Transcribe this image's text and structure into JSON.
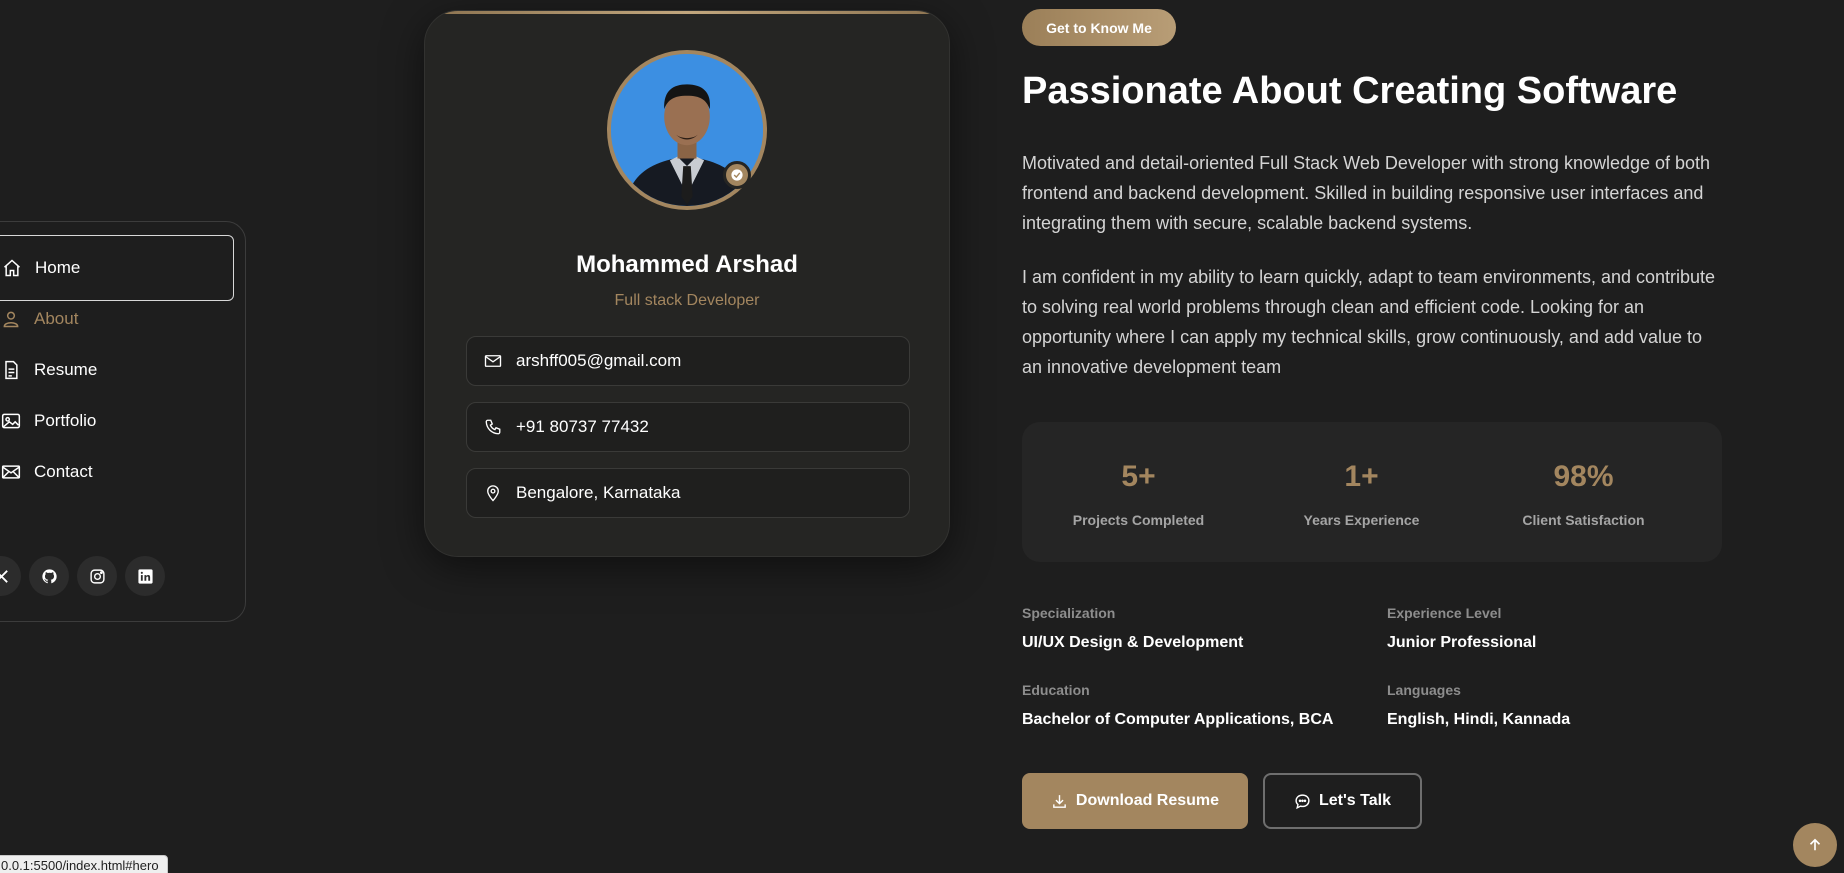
{
  "nav": {
    "items": [
      {
        "label": "Home",
        "icon": "home-icon"
      },
      {
        "label": "About",
        "icon": "user-icon"
      },
      {
        "label": "Resume",
        "icon": "document-icon"
      },
      {
        "label": "Portfolio",
        "icon": "image-icon"
      },
      {
        "label": "Contact",
        "icon": "mail-icon"
      }
    ],
    "socials": [
      "x-icon",
      "github-icon",
      "instagram-icon",
      "linkedin-icon"
    ]
  },
  "profile": {
    "name": "Mohammed Arshad",
    "role": "Full stack Developer",
    "email": "arshff005@gmail.com",
    "phone": "+91 80737 77432",
    "location": "Bengalore, Karnataka"
  },
  "about": {
    "badge": "Get to Know Me",
    "heading": "Passionate About Creating Software",
    "paragraph1": "Motivated and detail-oriented Full Stack Web Developer with strong knowledge of both frontend and backend development. Skilled in building responsive user interfaces and integrating them with secure, scalable backend systems.",
    "paragraph2": "I am confident in my ability to learn quickly, adapt to team environments, and contribute to solving real world problems through clean and efficient code. Looking for an opportunity where I can apply my technical skills, grow continuously, and add value to an innovative development team",
    "stats": [
      {
        "value": "5+",
        "label": "Projects Completed"
      },
      {
        "value": "1+",
        "label": "Years Experience"
      },
      {
        "value": "98%",
        "label": "Client Satisfaction"
      }
    ],
    "details": {
      "specialization_label": "Specialization",
      "specialization_value": "UI/UX Design & Development",
      "experience_label": "Experience Level",
      "experience_value": "Junior Professional",
      "education_label": "Education",
      "education_value": "Bachelor of Computer Applications, BCA",
      "languages_label": "Languages",
      "languages_value": "English, Hindi, Kannada"
    },
    "download_button": "Download Resume",
    "talk_button": "Let's Talk"
  },
  "status_url": "0.0.1:5500/index.html#hero",
  "colors": {
    "accent": "#a3865f",
    "background": "#1e1e1e",
    "card": "#252523"
  }
}
